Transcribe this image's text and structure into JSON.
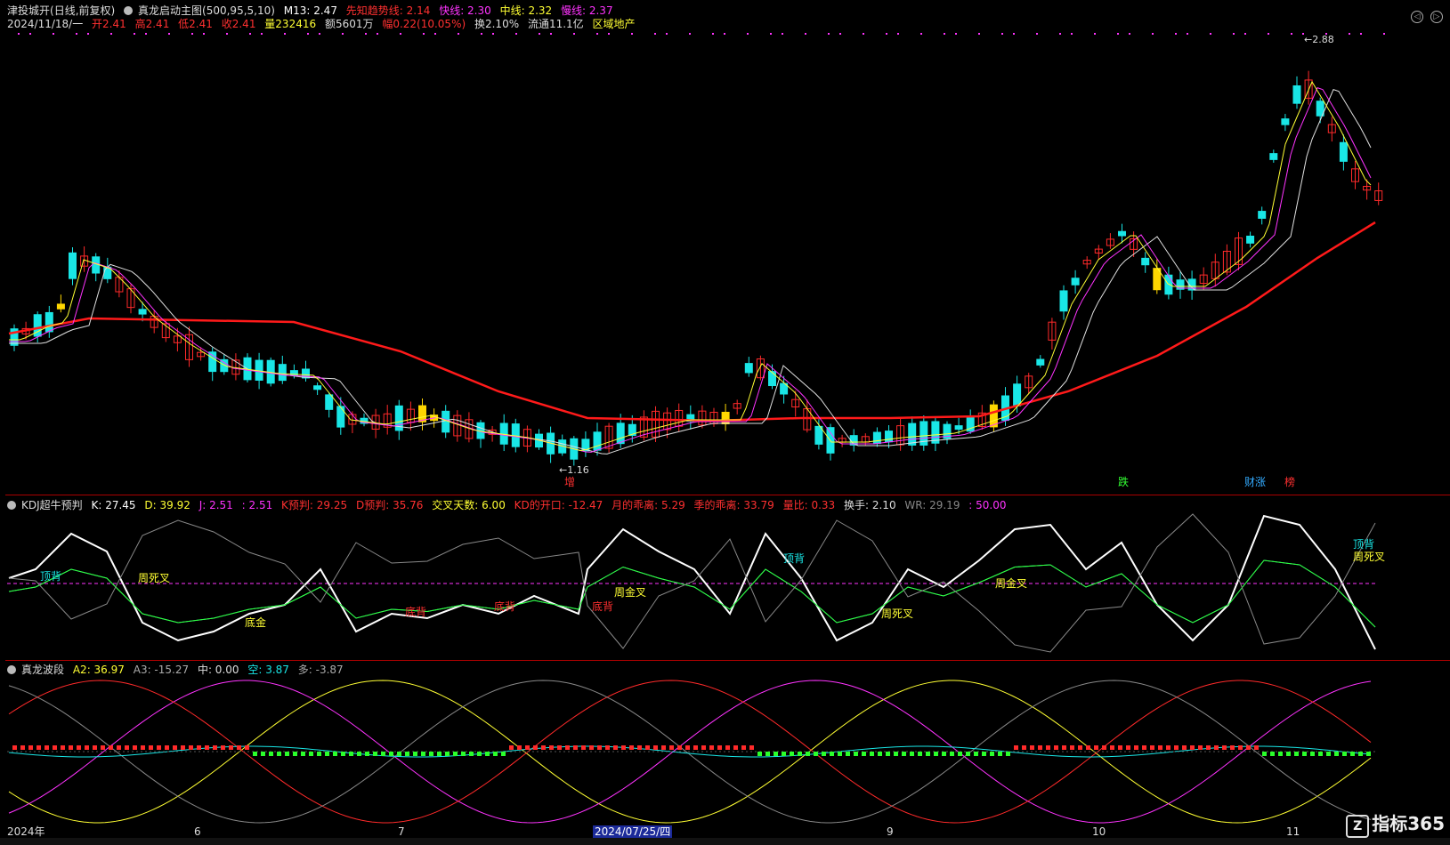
{
  "header": {
    "stock_name": "津投城开",
    "mode": "(日线,前复权)",
    "indicator": "真龙启动主图(500,95,5,10)",
    "m13": "M13: 2.47",
    "xz": "先知趋势线: 2.14",
    "fast": "快线: 2.30",
    "mid": "中线: 2.32",
    "slow": "慢线: 2.37",
    "date": "2024/11/18/一",
    "open": "开2.41",
    "high": "高2.41",
    "low": "低2.41",
    "close": "收2.41",
    "vol": "量232416",
    "amount": "额5601万",
    "chg": "幅0.22(10.05%)",
    "turnover": "换2.10%",
    "float": "流通11.1亿",
    "sector": "区域地产"
  },
  "kdj_header": {
    "name": "KDJ超牛预判",
    "k": "K: 27.45",
    "d": "D: 39.92",
    "j": "J: 2.51",
    "j2": ": 2.51",
    "kp": "K预判: 29.25",
    "dp": "D预判: 35.76",
    "cross": "交叉天数: 6.00",
    "kdopen": "KD的开口: -12.47",
    "month": "月的乖离: 5.29",
    "season": "季的乖离: 33.79",
    "volratio": "量比: 0.33",
    "turn": "换手: 2.10",
    "wr": "WR: 29.19",
    "fifty": ": 50.00"
  },
  "wave_header": {
    "name": "真龙波段",
    "a2": "A2: 36.97",
    "a3": "A3: -15.27",
    "zhong": "中: 0.00",
    "kong": "空: 3.87",
    "duo": "多: -3.87"
  },
  "labels": {
    "low_price": "1.16",
    "high_price": "2.88",
    "zeng": "增",
    "die": "跌",
    "caizhang": "财涨",
    "bang": "榜",
    "dingbei": "顶背",
    "zhousicha": "周死叉",
    "zhoujincha": "周金叉",
    "dibei": "底背",
    "dijin": "底金"
  },
  "axis": {
    "year": "2024年",
    "m6": "6",
    "m7": "7",
    "hl_date": "2024/07/25/四",
    "m9": "9",
    "m10": "10",
    "m11": "11"
  },
  "logo": {
    "z": "Z",
    "text": "指标365"
  },
  "colors": {
    "up": "#ff2a2a",
    "down": "#19e6e6",
    "yellow": "#ffd700",
    "magenta": "#ff33ff",
    "ma": "#ff1a1a"
  }
}
